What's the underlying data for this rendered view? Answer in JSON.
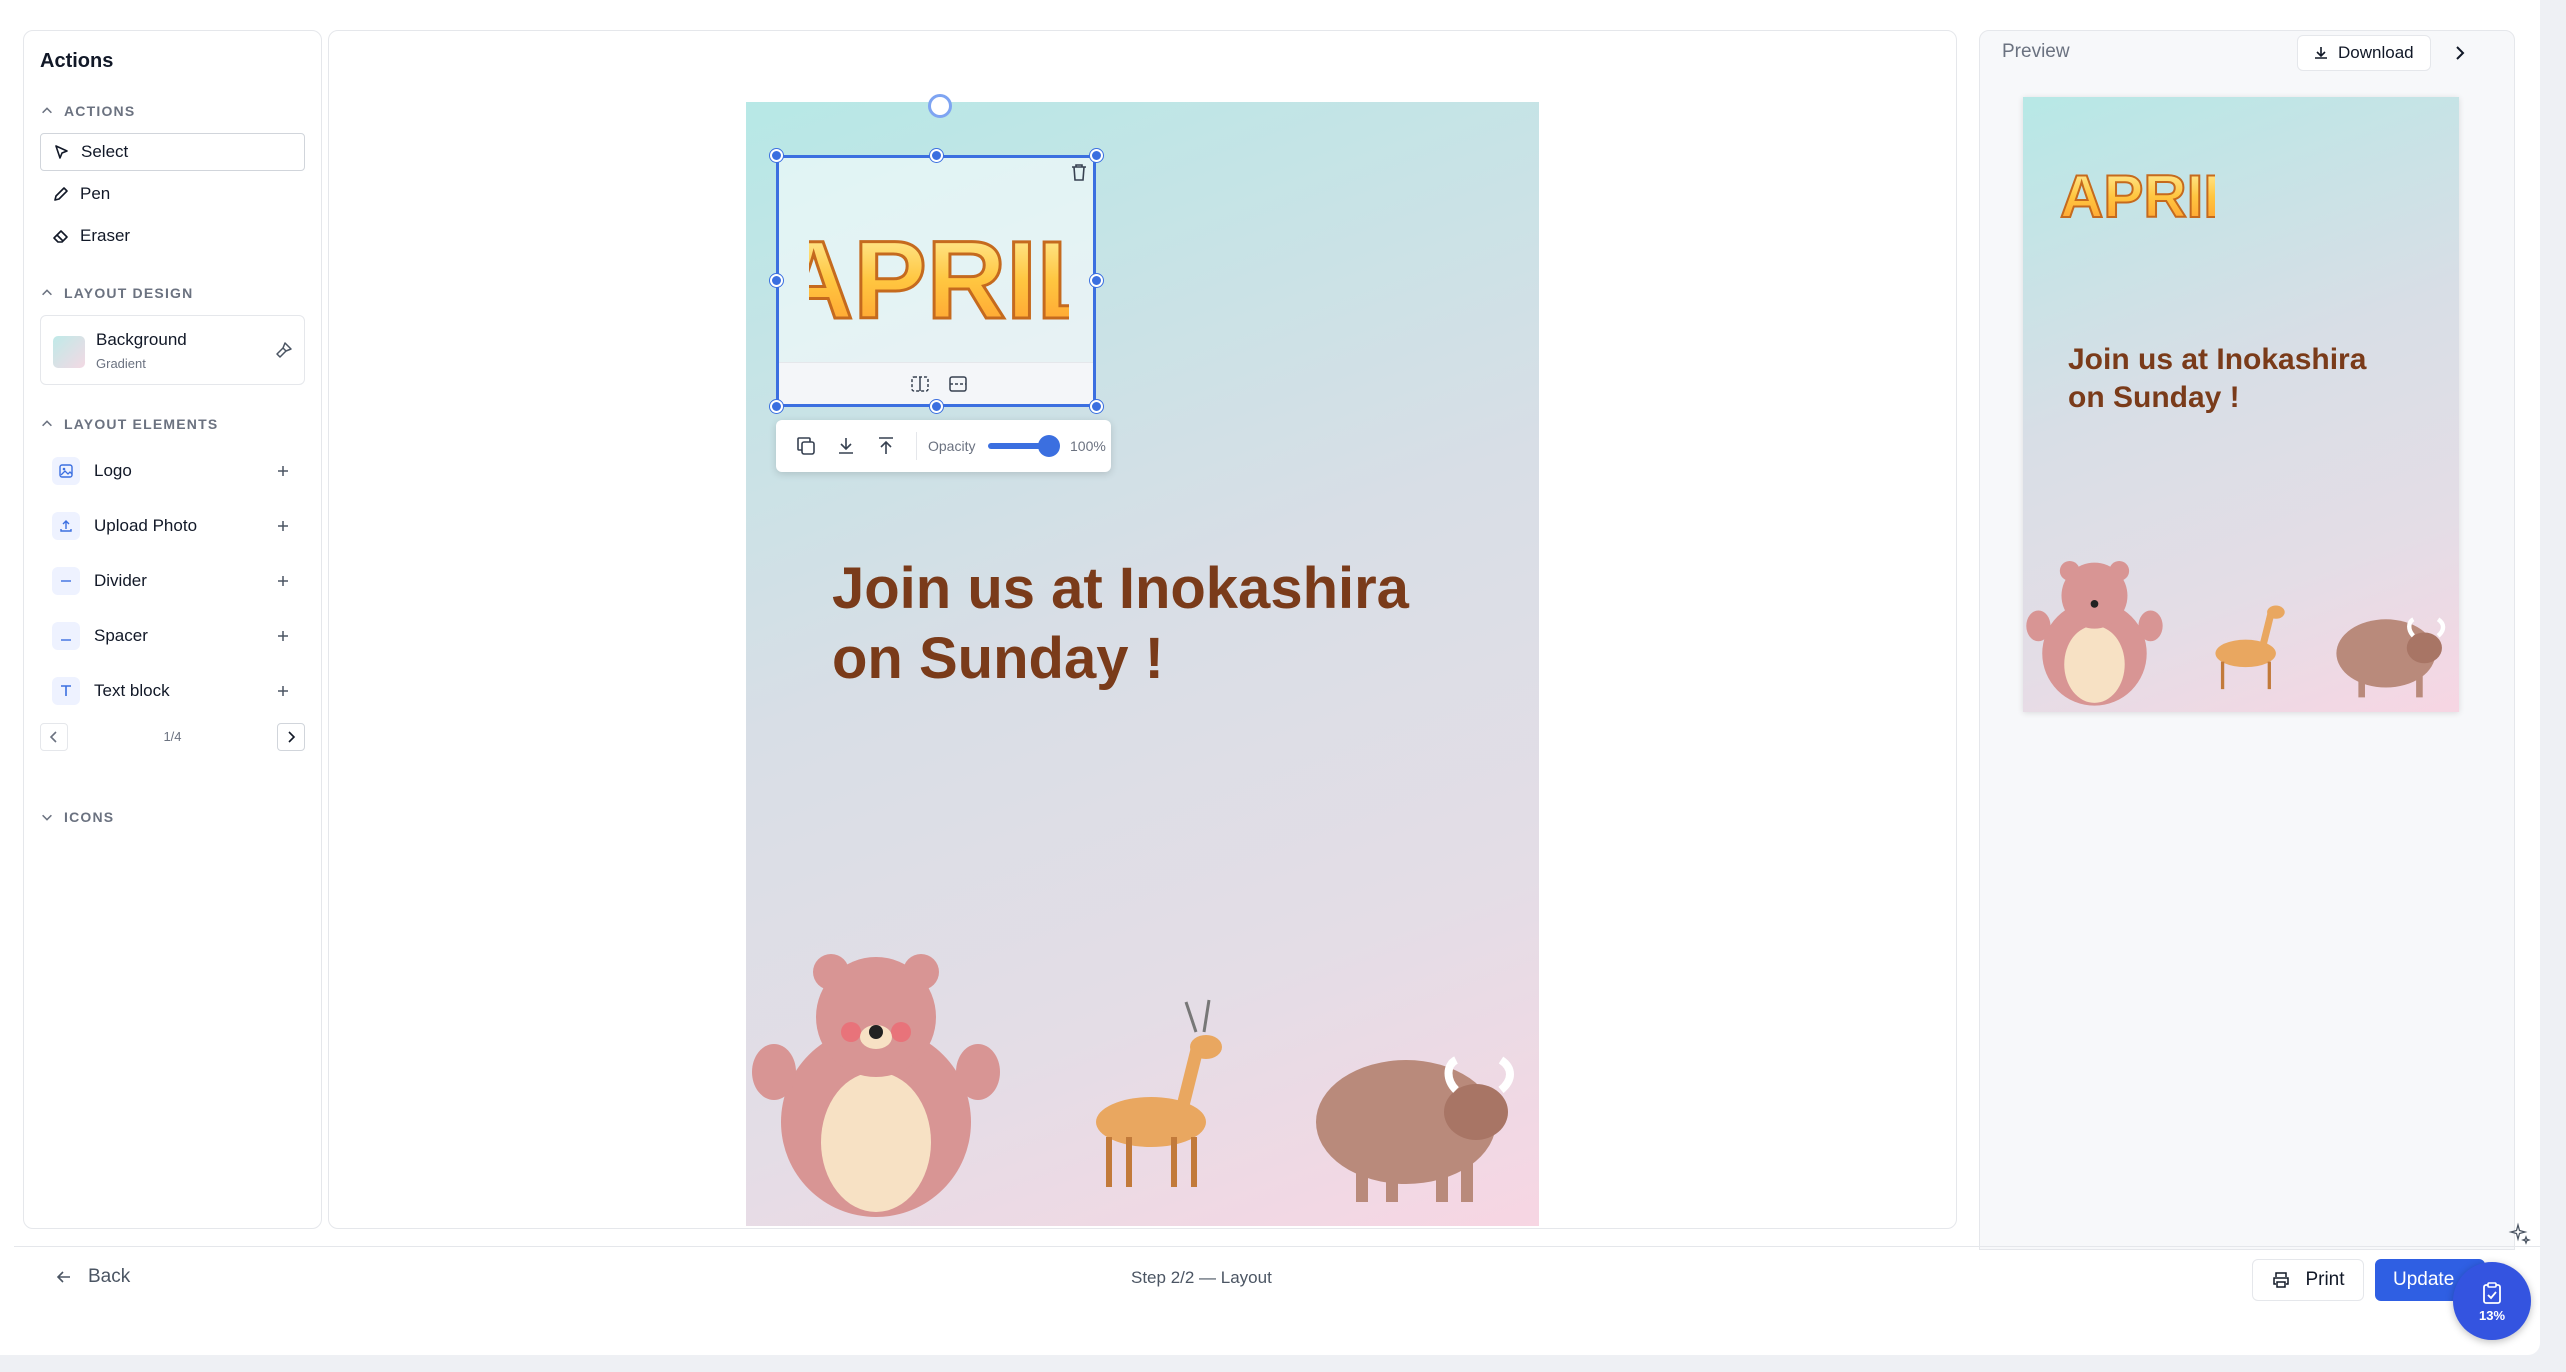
{
  "sidebar": {
    "title": "Actions",
    "actions_section": "ACTIONS",
    "actions": [
      {
        "label": "Select"
      },
      {
        "label": "Pen"
      },
      {
        "label": "Eraser"
      }
    ],
    "layout_design_section": "LAYOUT DESIGN",
    "background": {
      "title": "Background",
      "subtitle": "Gradient"
    },
    "layout_elements_section": "LAYOUT ELEMENTS",
    "elements": [
      {
        "label": "Logo"
      },
      {
        "label": "Upload Photo"
      },
      {
        "label": "Divider"
      },
      {
        "label": "Spacer"
      },
      {
        "label": "Text block"
      }
    ],
    "pager": "1/4",
    "icons_section": "ICONS"
  },
  "canvas": {
    "logo_word": "APRIL",
    "headline_line1": "Join us at Inokashira",
    "headline_line2": "on Sunday !",
    "toolbar": {
      "opacity_label": "Opacity",
      "opacity_value": "100%",
      "opacity_fraction": 1.0
    }
  },
  "preview": {
    "title": "Preview",
    "download_label": "Download",
    "logo_word": "APRIL",
    "headline_line1": "Join us at Inokashira",
    "headline_line2": "on Sunday !"
  },
  "footer": {
    "back_label": "Back",
    "step": "Step 2/2 — Layout",
    "print_label": "Print",
    "update_label": "Update",
    "progress_badge": "13%"
  },
  "colors": {
    "accent": "#2f5fe3",
    "selection": "#3b6fe0",
    "headline": "#7a3b1a",
    "gradient_top": "#b7e8e6",
    "gradient_bottom": "#f7d6e3"
  }
}
